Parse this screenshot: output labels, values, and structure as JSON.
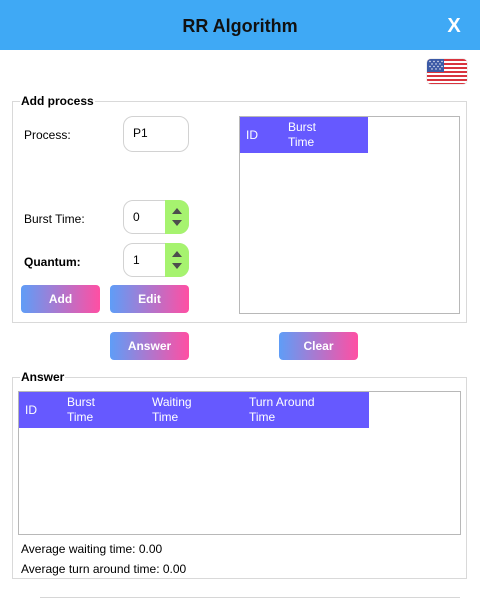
{
  "window": {
    "title": "RR Algorithm",
    "close_label": "X"
  },
  "language": {
    "icon": "us-flag-icon"
  },
  "add_process": {
    "group_label": "Add process",
    "process_label": "Process:",
    "process_value": "P1",
    "burst_label": "Burst Time:",
    "burst_value": "0",
    "quantum_label": "Quantum:",
    "quantum_value": "1",
    "add_label": "Add",
    "edit_label": "Edit"
  },
  "process_table": {
    "columns": [
      "ID",
      "Burst Time"
    ],
    "rows": []
  },
  "actions": {
    "answer_label": "Answer",
    "clear_label": "Clear"
  },
  "answer": {
    "group_label": "Answer",
    "columns": [
      "ID",
      "Burst Time",
      "Waiting Time",
      "Turn Around Time"
    ],
    "rows": [],
    "avg_waiting_text": "Average waiting time: 0.00",
    "avg_turnaround_text": "Average turn around time: 0.00"
  },
  "colors": {
    "titlebar": "#3fa9f5",
    "table_header": "#6659ff",
    "spinner": "#a6f36f",
    "button_gradient_start": "#5f9df7",
    "button_gradient_end": "#ff4fa3"
  }
}
